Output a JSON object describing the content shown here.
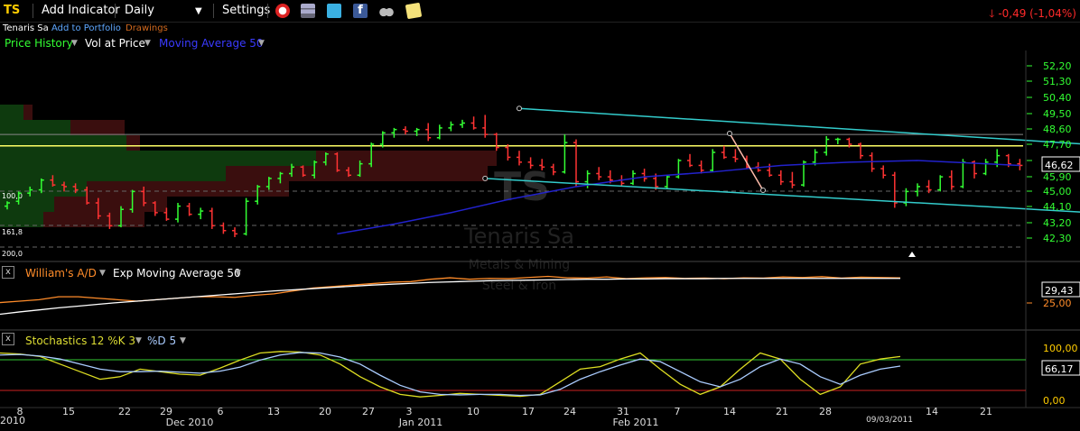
{
  "toolbar": {
    "ticker": "TS",
    "add_indicator": "Add Indicator",
    "interval": "Daily",
    "settings": "Settings",
    "change": "-0,49 (-1,04%)",
    "icons": [
      "clock-icon",
      "layers-icon",
      "twitter-icon",
      "facebook-icon",
      "binoculars-icon",
      "note-icon"
    ]
  },
  "subheader": {
    "company": "Tenaris Sa",
    "add_to_portfolio": "Add to Portfolio",
    "drawings": "Drawings"
  },
  "main_legend": {
    "price_history": "Price History",
    "vol_at_price": "Vol at Price",
    "moving_average": "Moving Average 50"
  },
  "watermark": {
    "symbol": "TS",
    "name": "Tenaris Sa",
    "sector": "Metals & Mining",
    "industry": "Steel & Iron"
  },
  "fib_labels": [
    "100,0",
    "161,8",
    "200,0"
  ],
  "panel2": {
    "close": "x",
    "title1": "William's A/D",
    "title2": "Exp Moving Average 50"
  },
  "panel3": {
    "close": "x",
    "title1": "Stochastics 12 %K 3",
    "title2": "%D 5"
  },
  "colors": {
    "up": "#33ff33",
    "down": "#ff3333",
    "ma": "#2222cc",
    "trend": "#33cccc",
    "yellow": "#ffff66",
    "orange": "#ff8c2a"
  },
  "chart_data": [
    {
      "type": "bar",
      "title": "TS",
      "axis_labels": [
        "52,20",
        "51,30",
        "50,40",
        "49,50",
        "48,60",
        "47,70",
        "46,80",
        "45,90",
        "45,00",
        "44,10",
        "43,20",
        "42,30"
      ],
      "ylim": [
        41.6,
        53.0
      ],
      "last_value": "46,62",
      "ohlc": [
        [
          44.0,
          44.3,
          43.8,
          44.2
        ],
        [
          44.3,
          44.9,
          44.1,
          44.8
        ],
        [
          44.8,
          45.2,
          44.6,
          45.0
        ],
        [
          45.0,
          45.7,
          44.8,
          45.6
        ],
        [
          45.6,
          45.9,
          45.2,
          45.3
        ],
        [
          45.3,
          45.5,
          44.9,
          45.2
        ],
        [
          45.2,
          45.4,
          44.8,
          45.0
        ],
        [
          45.0,
          45.2,
          44.1,
          44.2
        ],
        [
          44.2,
          44.5,
          43.2,
          43.4
        ],
        [
          43.4,
          43.6,
          42.6,
          42.8
        ],
        [
          42.8,
          44.0,
          42.7,
          43.8
        ],
        [
          43.8,
          45.0,
          43.6,
          44.9
        ],
        [
          44.9,
          45.2,
          44.0,
          44.2
        ],
        [
          44.2,
          44.3,
          43.4,
          43.6
        ],
        [
          43.6,
          43.9,
          43.1,
          43.2
        ],
        [
          43.2,
          44.2,
          43.0,
          44.0
        ],
        [
          44.0,
          44.2,
          43.4,
          43.5
        ],
        [
          43.5,
          43.9,
          43.2,
          43.7
        ],
        [
          43.7,
          43.9,
          42.6,
          42.8
        ],
        [
          42.8,
          43.0,
          42.3,
          42.5
        ],
        [
          42.5,
          42.7,
          42.1,
          42.3
        ],
        [
          42.3,
          44.5,
          42.2,
          44.3
        ],
        [
          44.3,
          45.3,
          44.1,
          45.2
        ],
        [
          45.2,
          45.8,
          45.0,
          45.7
        ],
        [
          45.7,
          46.1,
          45.4,
          46.0
        ],
        [
          46.0,
          46.6,
          45.8,
          46.4
        ],
        [
          46.4,
          46.5,
          45.8,
          45.9
        ],
        [
          45.9,
          46.8,
          45.7,
          46.7
        ],
        [
          46.7,
          47.3,
          46.5,
          47.2
        ],
        [
          47.2,
          47.3,
          46.1,
          46.2
        ],
        [
          46.2,
          46.4,
          45.8,
          45.9
        ],
        [
          45.9,
          46.8,
          45.8,
          46.6
        ],
        [
          46.6,
          47.9,
          46.4,
          47.8
        ],
        [
          47.8,
          48.6,
          47.6,
          48.5
        ],
        [
          48.5,
          48.8,
          48.2,
          48.7
        ],
        [
          48.7,
          48.9,
          48.4,
          48.6
        ],
        [
          48.6,
          48.8,
          48.3,
          48.7
        ],
        [
          48.7,
          49.1,
          48.0,
          48.2
        ],
        [
          48.2,
          49.0,
          48.1,
          48.8
        ],
        [
          48.8,
          49.2,
          48.6,
          49.0
        ],
        [
          49.0,
          49.3,
          48.8,
          49.1
        ],
        [
          49.1,
          49.5,
          48.7,
          48.8
        ],
        [
          48.8,
          49.6,
          48.2,
          48.4
        ],
        [
          48.4,
          48.5,
          47.4,
          47.6
        ],
        [
          47.6,
          47.8,
          46.8,
          47.0
        ],
        [
          47.0,
          47.4,
          46.5,
          46.7
        ],
        [
          46.7,
          47.0,
          46.3,
          46.5
        ],
        [
          46.5,
          46.9,
          46.2,
          46.4
        ],
        [
          46.4,
          46.6,
          45.9,
          46.1
        ],
        [
          46.1,
          48.4,
          46.0,
          47.9
        ],
        [
          47.9,
          48.1,
          45.2,
          45.5
        ],
        [
          45.5,
          46.2,
          45.1,
          46.0
        ],
        [
          46.0,
          46.4,
          45.6,
          45.8
        ],
        [
          45.8,
          46.2,
          45.4,
          45.6
        ],
        [
          45.6,
          45.9,
          45.2,
          45.4
        ],
        [
          45.4,
          46.2,
          45.3,
          46.0
        ],
        [
          46.0,
          46.3,
          45.5,
          45.7
        ],
        [
          45.7,
          46.0,
          45.0,
          45.2
        ],
        [
          45.2,
          45.9,
          45.1,
          45.8
        ],
        [
          45.8,
          46.9,
          45.7,
          46.8
        ],
        [
          46.8,
          47.2,
          46.4,
          46.5
        ],
        [
          46.5,
          46.8,
          46.0,
          46.2
        ],
        [
          46.2,
          47.5,
          46.1,
          47.3
        ],
        [
          47.3,
          47.7,
          46.9,
          47.0
        ],
        [
          47.0,
          47.5,
          46.7,
          46.9
        ],
        [
          46.9,
          47.1,
          46.3,
          46.4
        ],
        [
          46.4,
          46.7,
          46.1,
          46.2
        ],
        [
          46.2,
          46.6,
          45.8,
          45.9
        ],
        [
          45.9,
          46.2,
          45.3,
          45.5
        ],
        [
          45.5,
          46.1,
          45.1,
          45.3
        ],
        [
          45.3,
          46.8,
          45.2,
          46.7
        ],
        [
          46.7,
          47.5,
          46.5,
          47.3
        ],
        [
          47.3,
          48.3,
          47.1,
          48.1
        ],
        [
          48.1,
          48.2,
          47.8,
          48.1
        ],
        [
          48.1,
          48.2,
          47.6,
          47.8
        ],
        [
          47.8,
          47.9,
          46.9,
          47.1
        ],
        [
          47.1,
          47.3,
          46.1,
          46.3
        ],
        [
          46.3,
          46.5,
          45.7,
          45.9
        ],
        [
          45.9,
          46.1,
          43.9,
          44.2
        ],
        [
          44.2,
          45.1,
          44.0,
          44.9
        ],
        [
          44.9,
          45.4,
          44.6,
          45.2
        ],
        [
          45.2,
          45.6,
          44.8,
          45.0
        ],
        [
          45.0,
          45.9,
          44.9,
          45.8
        ],
        [
          45.8,
          46.2,
          45.0,
          45.2
        ],
        [
          45.2,
          46.9,
          45.1,
          46.7
        ],
        [
          46.7,
          46.8,
          45.7,
          46.0
        ],
        [
          46.0,
          46.9,
          45.9,
          46.7
        ],
        [
          46.7,
          47.5,
          46.4,
          47.1
        ],
        [
          47.1,
          47.2,
          46.4,
          46.6
        ],
        [
          46.6,
          46.9,
          46.2,
          46.5
        ]
      ],
      "ma50": [
        [
          29,
          42.3
        ],
        [
          34,
          42.9
        ],
        [
          39,
          43.6
        ],
        [
          44,
          44.4
        ],
        [
          50,
          45.2
        ],
        [
          56,
          45.8
        ],
        [
          62,
          46.1
        ],
        [
          68,
          46.5
        ],
        [
          74,
          46.7
        ],
        [
          80,
          46.8
        ],
        [
          86,
          46.6
        ],
        [
          89,
          46.5
        ]
      ],
      "horizontal_lines": [
        {
          "value": 47.7,
          "color": "#ffff66"
        },
        {
          "value": 48.4,
          "color": "#888888"
        }
      ],
      "trendlines": [
        {
          "from": [
            45,
            50.0
          ],
          "to": [
            104,
            47.4
          ]
        },
        {
          "from": [
            42,
            45.7
          ],
          "to": [
            103,
            43.3
          ]
        }
      ]
    },
    {
      "type": "line",
      "title": "William's A/D",
      "axis_labels": [
        "25,00"
      ],
      "last_value": "29,43",
      "series": [
        {
          "name": "William's A/D",
          "values": [
            21,
            21.5,
            22,
            23,
            23,
            22.5,
            22,
            21.5,
            22,
            22.5,
            23,
            23,
            22.8,
            23.5,
            24,
            25,
            26,
            26.5,
            27,
            27.5,
            28,
            28.2,
            29,
            29.5,
            29,
            29.3,
            29.2,
            29.6,
            30,
            29.5,
            29.4,
            29.8,
            29.2,
            29.5,
            29.6,
            29.3,
            29.4,
            29.2,
            29.5,
            29.4,
            29.8,
            29.6,
            29.9,
            29.4,
            29.7,
            29.6,
            29.5
          ]
        },
        {
          "name": "Exp Moving Average 50",
          "values": [
            17,
            17.8,
            18.5,
            19.2,
            19.8,
            20.4,
            21,
            21.5,
            22,
            22.5,
            23,
            23.5,
            24,
            24.5,
            25,
            25.4,
            25.8,
            26.2,
            26.6,
            27,
            27.3,
            27.6,
            27.9,
            28.1,
            28.3,
            28.5,
            28.6,
            28.7,
            28.8,
            28.9,
            29,
            29,
            29.1,
            29.1,
            29.2,
            29.2,
            29.2,
            29.3,
            29.3,
            29.3,
            29.3,
            29.3,
            29.3,
            29.3,
            29.3,
            29.3,
            29.3
          ]
        }
      ]
    },
    {
      "type": "line",
      "title": "Stochastics",
      "axis_labels": [
        "100,00",
        "0,00"
      ],
      "last_value": "66,17",
      "series": [
        {
          "name": "%K",
          "values": [
            92,
            90,
            85,
            70,
            55,
            40,
            45,
            60,
            55,
            50,
            48,
            62,
            78,
            92,
            95,
            94,
            88,
            70,
            45,
            25,
            10,
            5,
            8,
            12,
            10,
            8,
            6,
            10,
            35,
            60,
            65,
            80,
            92,
            60,
            30,
            10,
            25,
            60,
            92,
            80,
            40,
            10,
            25,
            70,
            80,
            85
          ]
        },
        {
          "name": "%D",
          "values": [
            88,
            89,
            86,
            80,
            70,
            60,
            55,
            55,
            56,
            54,
            52,
            56,
            64,
            78,
            88,
            93,
            92,
            84,
            70,
            48,
            28,
            15,
            10,
            9,
            10,
            10,
            8,
            9,
            20,
            40,
            55,
            68,
            80,
            75,
            55,
            35,
            25,
            40,
            65,
            80,
            70,
            45,
            30,
            48,
            60,
            66
          ]
        }
      ],
      "ref_lines": [
        {
          "value": 80,
          "color": "#33cc33"
        },
        {
          "value": 20,
          "color": "#cc2222"
        }
      ]
    }
  ],
  "x_axis": {
    "labels": [
      "2010",
      "8",
      "15",
      "22",
      "29",
      "Dec 2010",
      "6",
      "13",
      "20",
      "27",
      "3",
      "Jan 2011",
      "10",
      "17",
      "24",
      "31",
      "Feb 2011",
      "7",
      "14",
      "21",
      "28",
      "09/03/2011",
      "14",
      "21"
    ]
  }
}
